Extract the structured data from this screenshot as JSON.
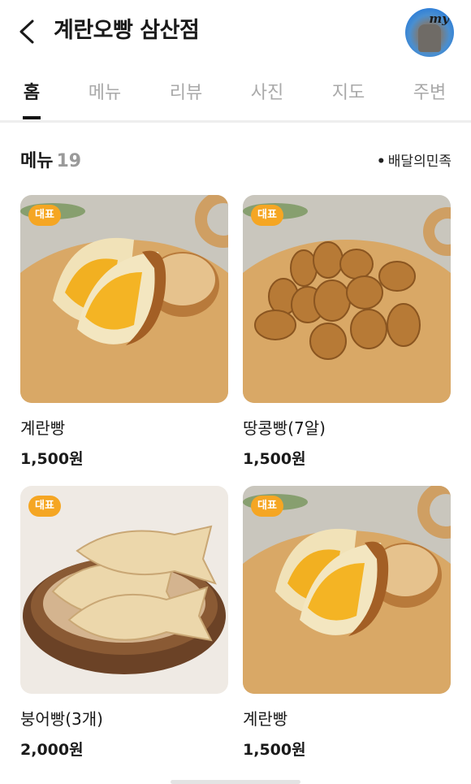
{
  "header": {
    "title": "계란오빵 삼산점",
    "avatar_label": "my"
  },
  "tabs": [
    {
      "label": "홈",
      "active": true
    },
    {
      "label": "메뉴",
      "active": false
    },
    {
      "label": "리뷰",
      "active": false
    },
    {
      "label": "사진",
      "active": false
    },
    {
      "label": "지도",
      "active": false
    },
    {
      "label": "주변",
      "active": false
    }
  ],
  "menu_section": {
    "title": "메뉴",
    "count": "19",
    "delivery_link": "배달의민족"
  },
  "menu_items": [
    {
      "badge": "대표",
      "name": "계란빵",
      "price": "1,500원",
      "image": "egg-bread"
    },
    {
      "badge": "대표",
      "name": "땅콩빵(7알)",
      "price": "1,500원",
      "image": "peanut-bread"
    },
    {
      "badge": "대표",
      "name": "붕어빵(3개)",
      "price": "2,000원",
      "image": "fish-bread"
    },
    {
      "badge": "대표",
      "name": "계란빵",
      "price": "1,500원",
      "image": "egg-bread"
    }
  ],
  "colors": {
    "badge": "#f5a623",
    "active_tab": "#1a1a1a",
    "inactive_tab": "#a9a9a9"
  }
}
